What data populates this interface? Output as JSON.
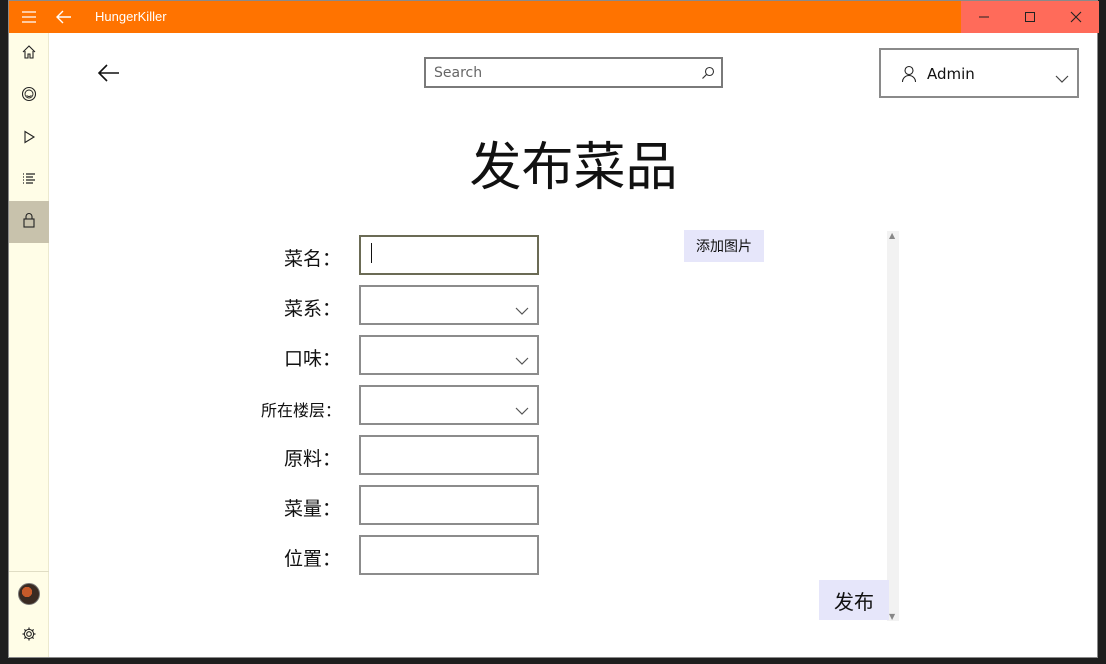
{
  "titlebar": {
    "app_title": "HungerKiller",
    "colors": {
      "bar": "#ff7300",
      "controls": "#ff6b5a"
    },
    "icons": [
      "hamburger-icon",
      "back-arrow-icon",
      "minimize-icon",
      "maximize-icon",
      "close-icon"
    ]
  },
  "nav": {
    "items": [
      {
        "icon": "home-icon"
      },
      {
        "icon": "smiley-icon"
      },
      {
        "icon": "play-icon"
      },
      {
        "icon": "list-icon"
      },
      {
        "icon": "lock-icon",
        "selected": true
      }
    ],
    "bottom": [
      {
        "icon": "avatar"
      },
      {
        "icon": "gear-icon"
      }
    ]
  },
  "header": {
    "search": {
      "placeholder": "Search",
      "value": ""
    },
    "user": {
      "name": "Admin"
    }
  },
  "page": {
    "title": "发布菜品",
    "form": {
      "name_label": "菜名：",
      "cuisine_label": "菜系：",
      "taste_label": "口味：",
      "floor_label": "所在楼层：",
      "ingredients_label": "原料：",
      "portion_label": "菜量：",
      "location_label": "位置："
    },
    "add_image_label": "添加图片",
    "publish_label": "发布"
  },
  "colors": {
    "accent_button": "#e6e6fa",
    "nav_bg": "#fffde7",
    "nav_selected": "#c8c2ac"
  }
}
